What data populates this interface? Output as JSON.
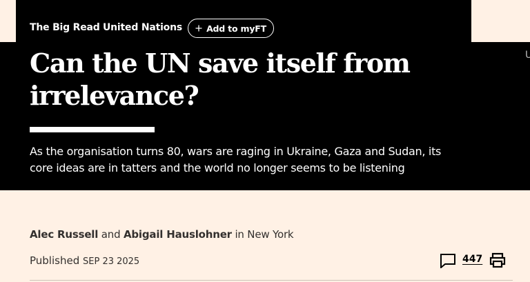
{
  "header": {
    "topics": [
      "The Big Read",
      "United Nations"
    ],
    "add_myft_label": "Add to myFT"
  },
  "article": {
    "headline": "Can the UN save itself from irrelevance?",
    "standfirst": "As the organisation turns 80, wars are raging in Ukraine, Gaza and Sudan, its core ideas are in tatters and the world no longer seems to be listening",
    "edge_glyph": "U"
  },
  "byline": {
    "author1": "Alec Russell",
    "joiner": "and",
    "author2": "Abigail Hauslohner",
    "location": "in New York"
  },
  "meta": {
    "published_label": "Published",
    "published_date": "SEP 23 2025",
    "comment_count": "447"
  },
  "icons": {
    "myft": "plus-icon",
    "comments": "comment-icon",
    "print": "print-icon"
  },
  "colors": {
    "page_bg": "#fff1e5",
    "hero_bg": "#000000",
    "hero_text": "#ffffff",
    "body_text": "#33302e"
  }
}
